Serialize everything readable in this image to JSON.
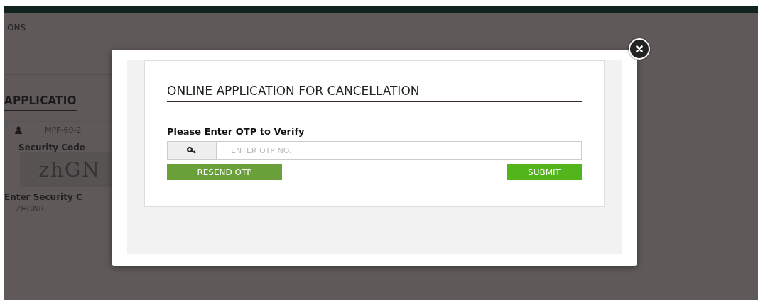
{
  "page": {
    "nav_text": "ONS",
    "heading": "APPLICATIO",
    "reference_value": "MPF-60-2",
    "security_code_label": "Security Code",
    "captcha_text": "zhGN",
    "security_input_label": "Enter Security C",
    "security_input_value": "ZHGNR"
  },
  "modal": {
    "title": "ONLINE APPLICATION FOR CANCELLATION",
    "prompt": "Please Enter OTP to Verify",
    "otp_field": {
      "placeholder": "ENTER OTP NO."
    },
    "buttons": [
      {
        "label": "RESEND OTP",
        "kind": "resend"
      },
      {
        "label": "SUBMIT",
        "kind": "submit"
      }
    ]
  }
}
